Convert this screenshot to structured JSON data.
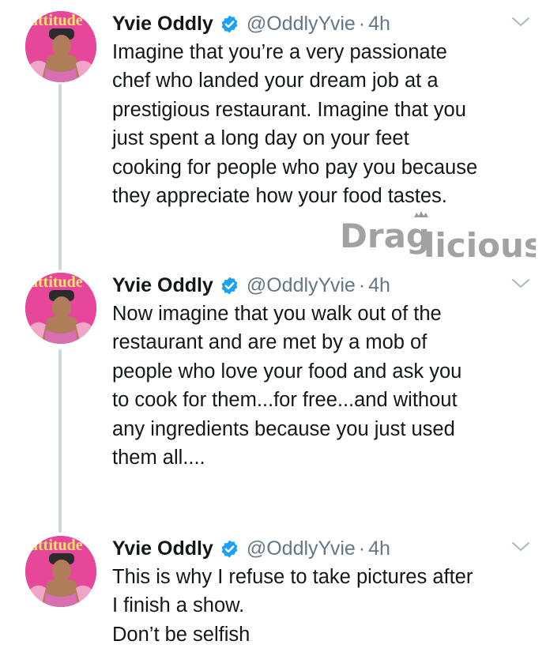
{
  "tweets": [
    {
      "author": {
        "name": "Yvie Oddly",
        "handle": "@OddlyYvie",
        "verified": true,
        "avatar_brand": "attitude"
      },
      "separator": "·",
      "time": "4h",
      "lines": [
        "Imagine that you’re a very passionate",
        "chef who landed your dream job at a",
        "prestigious restaurant. Imagine that you",
        "just spent a long day on your feet",
        "cooking for people who pay you because",
        "they appreciate how your food tastes."
      ]
    },
    {
      "author": {
        "name": "Yvie Oddly",
        "handle": "@OddlyYvie",
        "verified": true,
        "avatar_brand": "attitude"
      },
      "separator": "·",
      "time": "4h",
      "lines": [
        "Now imagine that you walk out of the",
        "restaurant and are met by a mob of",
        "people who love your food and ask you",
        "to cook for them...for free...and without",
        "any ingredients because you just used",
        "them all...."
      ]
    },
    {
      "author": {
        "name": "Yvie Oddly",
        "handle": "@OddlyYvie",
        "verified": true,
        "avatar_brand": "attitude"
      },
      "separator": "·",
      "time": "4h",
      "lines": [
        "This is why I refuse to take pictures after",
        "I finish a show.",
        "Don’t be selfish"
      ]
    }
  ],
  "watermark": {
    "text_dark": "Drag",
    "text_light": "licious"
  },
  "colors": {
    "text": "#14171a",
    "secondary": "#657786",
    "verified_badge": "#1da1f2",
    "thread_line": "#ccd6dd",
    "avatar_pink": "#e6479b",
    "watermark_gray": "#a2a2a2"
  },
  "icons": {
    "verified": "verified-badge-icon",
    "more": "chevron-down-icon",
    "avatar": "avatar-image"
  }
}
